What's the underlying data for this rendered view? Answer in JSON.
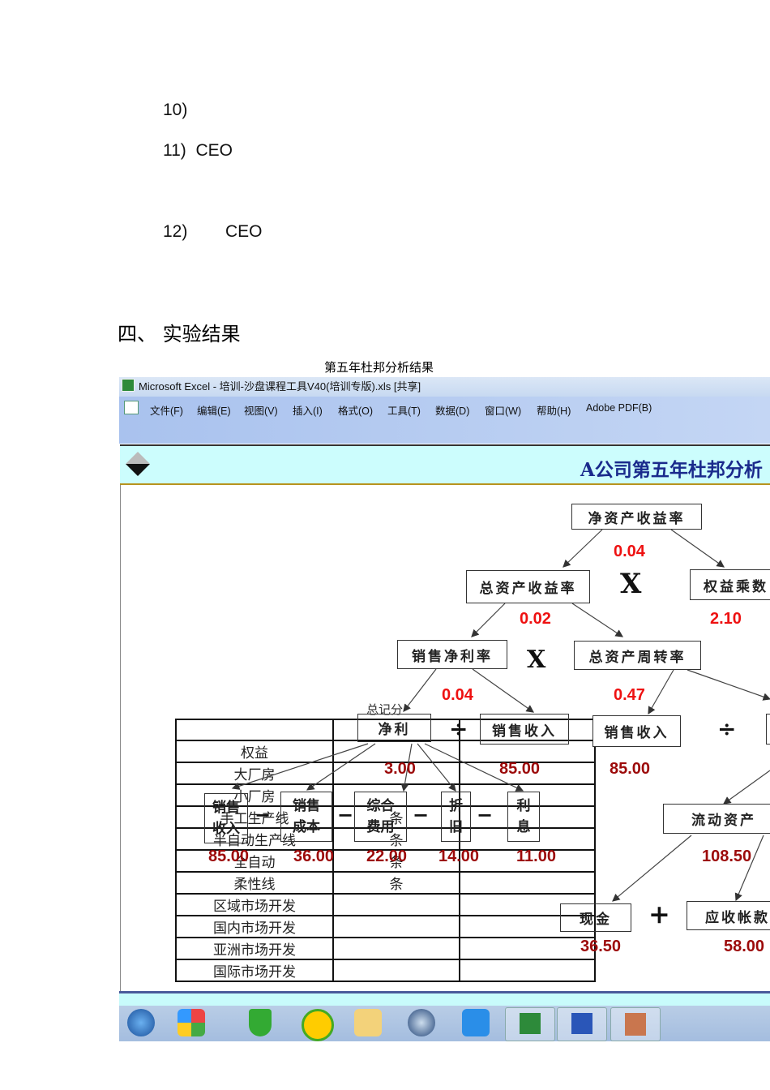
{
  "document": {
    "items": [
      {
        "num": "10)",
        "text": ""
      },
      {
        "num": "11)",
        "text": "CEO"
      },
      {
        "num": "12)",
        "text": "CEO"
      }
    ],
    "section_heading": "四、 实验结果",
    "figure_caption": "第五年杜邦分析结果"
  },
  "excel": {
    "window_title": "Microsoft Excel - 培训-沙盘课程工具V40(培训专版).xls  [共享]",
    "menu": [
      "文件(F)",
      "编辑(E)",
      "视图(V)",
      "插入(I)",
      "格式(O)",
      "工具(T)",
      "数据(D)",
      "窗口(W)",
      "帮助(H)",
      "Adobe PDF(B)"
    ],
    "header_title": "A公司第五年杜邦分析",
    "dupont": {
      "roe": {
        "label": "净资产收益率",
        "value": "0.04"
      },
      "roa": {
        "label": "总资产收益率",
        "value": "0.02"
      },
      "equity_multiplier": {
        "label": "权益乘数",
        "value": "2.10"
      },
      "net_margin": {
        "label": "销售净利率",
        "value": "0.04"
      },
      "asset_turnover": {
        "label": "总资产周转率",
        "value": "0.47"
      },
      "net_profit": {
        "label": "净利",
        "value": "3.00"
      },
      "sales_a": {
        "label": "销售收入",
        "value": "85.00"
      },
      "sales_b": {
        "label": "销售收入",
        "value": "85.00"
      },
      "sales_c": {
        "label1": "销售",
        "label2": "收入",
        "value": "85.00"
      },
      "cost": {
        "label1": "销售",
        "label2": "成本",
        "value": "36.00"
      },
      "expense": {
        "label1": "综合",
        "label2": "费用",
        "value": "22.00"
      },
      "depreciation": {
        "label1": "折",
        "label2": "旧",
        "value": "14.00"
      },
      "interest": {
        "label1": "利",
        "label2": "息",
        "value": "11.00"
      },
      "current_assets": {
        "label": "流动资产",
        "value": "108.50"
      },
      "cash": {
        "label": "现金",
        "value": "36.50"
      },
      "receivables": {
        "label": "应收帐款",
        "value": "58.00"
      },
      "ops": {
        "times": "X",
        "divide": "÷",
        "minus": "−",
        "plus": "+"
      },
      "overlay_text": "总记分"
    },
    "table": {
      "rows": [
        [
          "",
          ""
        ],
        [
          "权益",
          ""
        ],
        [
          "大厂房",
          ""
        ],
        [
          "小厂房",
          ""
        ],
        [
          "手工生产线",
          "条"
        ],
        [
          "半自动生产线",
          "条"
        ],
        [
          "全自动",
          "条"
        ],
        [
          "柔性线",
          "条"
        ],
        [
          "区域市场开发",
          ""
        ],
        [
          "国内市场开发",
          ""
        ],
        [
          "亚洲市场开发",
          ""
        ],
        [
          "国际市场开发",
          ""
        ]
      ]
    },
    "taskbar": [
      "start-button",
      "app-icon",
      "security-icon",
      "360-icon",
      "explorer-icon",
      "browser-icon",
      "qq-icon",
      "excel-icon",
      "word-icon",
      "photo-icon"
    ]
  }
}
